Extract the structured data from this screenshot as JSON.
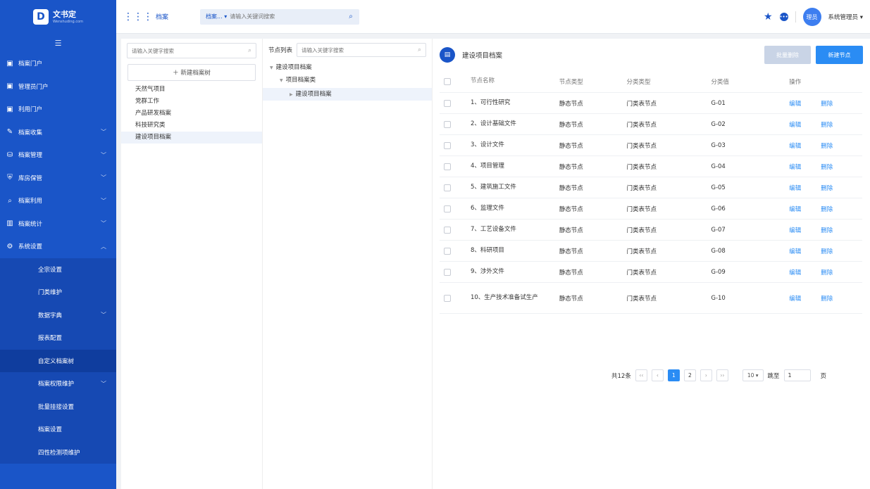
{
  "brand": {
    "name": "文书定",
    "sub": "Wenshuding.com",
    "mark": "D"
  },
  "sidebar": {
    "collapse_icon": "menu-fold-icon",
    "items": [
      {
        "label": "档案门户",
        "icon": "portal-icon"
      },
      {
        "label": "管理员门户",
        "icon": "portal-icon"
      },
      {
        "label": "利用门户",
        "icon": "portal-icon"
      },
      {
        "label": "档案收集",
        "icon": "edit-icon",
        "chevron": "﹀"
      },
      {
        "label": "档案管理",
        "icon": "briefcase-icon",
        "chevron": "﹀"
      },
      {
        "label": "库房保管",
        "icon": "shield-icon",
        "chevron": "﹀"
      },
      {
        "label": "档案利用",
        "icon": "file-search-icon",
        "chevron": "﹀"
      },
      {
        "label": "档案统计",
        "icon": "bar-chart-icon",
        "chevron": "﹀"
      },
      {
        "label": "系统设置",
        "icon": "gear-icon",
        "chevron": "︿"
      }
    ],
    "sub_items": [
      {
        "label": "全宗设置"
      },
      {
        "label": "门类维护"
      },
      {
        "label": "数据字典",
        "chevron": "﹀"
      },
      {
        "label": "报表配置"
      },
      {
        "label": "自定义档案树"
      },
      {
        "label": "档案权限维护",
        "chevron": "﹀"
      },
      {
        "label": "批量挂接设置"
      },
      {
        "label": "档案设置"
      },
      {
        "label": "四性检测项维护"
      }
    ]
  },
  "topbar": {
    "title": "档案",
    "search_select": "档案...",
    "search_placeholder": "请输入关键词搜索",
    "avatar_text": "理员",
    "user_name": "系统管理员"
  },
  "left_panel": {
    "search_placeholder": "请输入关键字搜索",
    "new_tree_label": "＋ 新建档案树",
    "trees": [
      "天然气项目",
      "党群工作",
      "产品研发档案",
      "科技研究类",
      "建设项目档案"
    ]
  },
  "mid_panel": {
    "label": "节点列表",
    "search_placeholder": "请输入关键字搜索",
    "nodes": [
      "建设项目档案",
      "项目档案类",
      "建设项目档案"
    ]
  },
  "main": {
    "title": "建设项目档案",
    "batch_delete": "批量删除",
    "new_node": "新建节点",
    "columns": [
      "节点名称",
      "节点类型",
      "分类类型",
      "分类值",
      "操作"
    ],
    "rows": [
      {
        "name": "1、可行性研究",
        "type": "静态节点",
        "cls": "门类表节点",
        "val": "G-01"
      },
      {
        "name": "2、设计基础文件",
        "type": "静态节点",
        "cls": "门类表节点",
        "val": "G-02"
      },
      {
        "name": "3、设计文件",
        "type": "静态节点",
        "cls": "门类表节点",
        "val": "G-03"
      },
      {
        "name": "4、项目管理",
        "type": "静态节点",
        "cls": "门类表节点",
        "val": "G-04"
      },
      {
        "name": "5、建筑施工文件",
        "type": "静态节点",
        "cls": "门类表节点",
        "val": "G-05"
      },
      {
        "name": "6、监理文件",
        "type": "静态节点",
        "cls": "门类表节点",
        "val": "G-06"
      },
      {
        "name": "7、工艺设备文件",
        "type": "静态节点",
        "cls": "门类表节点",
        "val": "G-07"
      },
      {
        "name": "8、科研项目",
        "type": "静态节点",
        "cls": "门类表节点",
        "val": "G-08"
      },
      {
        "name": "9、涉外文件",
        "type": "静态节点",
        "cls": "门类表节点",
        "val": "G-09"
      },
      {
        "name": "10、生产技术准备试生产",
        "type": "静态节点",
        "cls": "门类表节点",
        "val": "G-10"
      }
    ],
    "edit_label": "编辑",
    "delete_label": "删除"
  },
  "pager": {
    "total": "共12条",
    "pages": [
      "1",
      "2"
    ],
    "current": "1",
    "size": "10",
    "jump_label": "跳至",
    "jump_value": "1",
    "page_unit": "页"
  }
}
